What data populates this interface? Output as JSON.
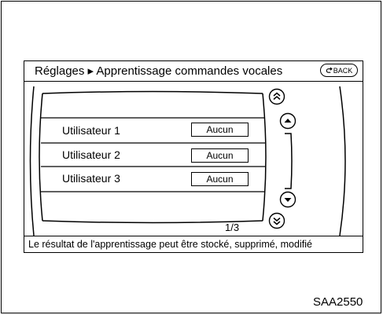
{
  "header": {
    "title": "Réglages ▸ Apprentissage commandes vocales",
    "back_label": "BACK"
  },
  "rows": [
    {
      "label": "Utilisateur 1",
      "value": "Aucun"
    },
    {
      "label": "Utilisateur 2",
      "value": "Aucun"
    },
    {
      "label": "Utilisateur 3",
      "value": "Aucun"
    }
  ],
  "pagination": {
    "current": "1/3"
  },
  "status_bar": {
    "text": "Le résultat de l'apprentissage peut être stocké, supprimé, modifié"
  },
  "figure_code": "SAA2550",
  "icons": {
    "back": "u-turn-arrow-icon",
    "page_up": "double-chevron-up-icon",
    "scroll_up": "chevron-up-icon",
    "scroll_down": "chevron-down-icon",
    "page_down": "double-chevron-down-icon"
  }
}
